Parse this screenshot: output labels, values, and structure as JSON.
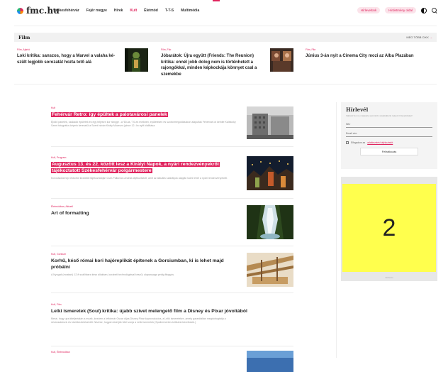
{
  "header": {
    "logo_text": "fmc.hu",
    "nav": [
      "Székesfehérvár",
      "Fejér megye",
      "Hírek",
      "Kult",
      "Életmód",
      "T-T-S",
      "Multimédia"
    ],
    "active_nav": "Kult",
    "pill_1": "Hírlevelünk",
    "pill_2": "Hirdetmény oldal"
  },
  "film": {
    "title": "Film",
    "more_label": "MÉG TÖBB CIKK",
    "cards": [
      {
        "category": "Film, Ajánló",
        "title": "Loki kritika: sanszos, hogy a Marvel a valaha ké­szült legjobb sorozatát hozta tető alá"
      },
      {
        "category": "Film, Fikr",
        "title": "Jóbarátok: Újra együtt (Friends: The Reunion) kritika: ennél jobb dolog nem is történhetett a rajongókkal, minden képkockája könnyet csal a szemekbe"
      },
      {
        "category": "Film, Fikr",
        "title": "Június 3-án nyit a Cinema City mozi az Alba Plazában"
      }
    ]
  },
  "articles": [
    {
      "category": "Kult",
      "title": "Fehérvár Retro: így épültek a palotavárosi panelek",
      "highlight": true,
      "desc": "Épülő panelek, szakadó épületek és egy teljesen kor ránygé - a '60-as, '70-es években, épületeken és szobormegoldásokon alapultak Fehérvárt.ot kel­ni­te Kalbiczky Szent fotográfus képein keresztül a Szent István Király Múzeum (pince 12- ön nyílt kiállítása."
    },
    {
      "category": "Kult, Program",
      "title": "Augusztus 13. és 22. között lesz a Királyi Napok, a nyári rendezvényekről tájékoztatott Székesfehérvár polgármestere",
      "highlight": true,
      "desc": "Koronázóünnepi ekkortól kezdődő tájékoztatóján Cser-Palkovics András tájékoztatott, amit az aktuális szabályok alapján tudni lehet a nyári rendezvényekről."
    },
    {
      "category": "Életmódban, Aktuell",
      "title": "Art of formatting",
      "highlight": false,
      "desc": ""
    },
    {
      "category": "Kult, Gorsium",
      "title": "Korhű, késő római kori hajóreplikát építenek a Gorsiumban, ki is lehet majd próbálni",
      "highlight": false,
      "desc": "A Nyugati (mostani) 12-ft szállításra kész állakban, korabeli technológiával készül, alapanyaga pedig fitogyás."
    },
    {
      "category": "Kult, Film",
      "title": "Lelki ismeretek (Soul) kritika: újabb szívet melengető film a Disney és Pixar jóvoltából",
      "highlight": false,
      "desc": "Mesé, hogy ujra kiteljeztalán a mozik, kezdem a leftórmár Oscar díjas Disney Pixar kopronukcióra, a Lelki ismeretekre, amely garanitáltan megdobogtatja a nézócsoktrunk és következtetésektől. Nézése, hogyan kisérjük hitet vonja a Lelki ismeretek (Spoilermentes kritikánk következik.)"
    },
    {
      "category": "Kult, Életmódban",
      "title": "",
      "highlight": false,
      "desc": ""
    }
  ],
  "newsletter": {
    "title": "Hírlevél",
    "subtitle": "Iratkozz fel, ne maradj le semmiről, szelektálunk neked, hírlevelünkkel!",
    "name_placeholder": "Név",
    "email_placeholder": "Email cím",
    "consent_prefix": "Elfogadom az",
    "consent_link": "adatkezelési tájékoztatót",
    "button_label": "Feliratkozás"
  },
  "ad": {
    "number": "2",
    "label": "Hirdetés"
  },
  "colors": {
    "accent": "#e0245e",
    "ad_yellow": "#ffff4d"
  }
}
